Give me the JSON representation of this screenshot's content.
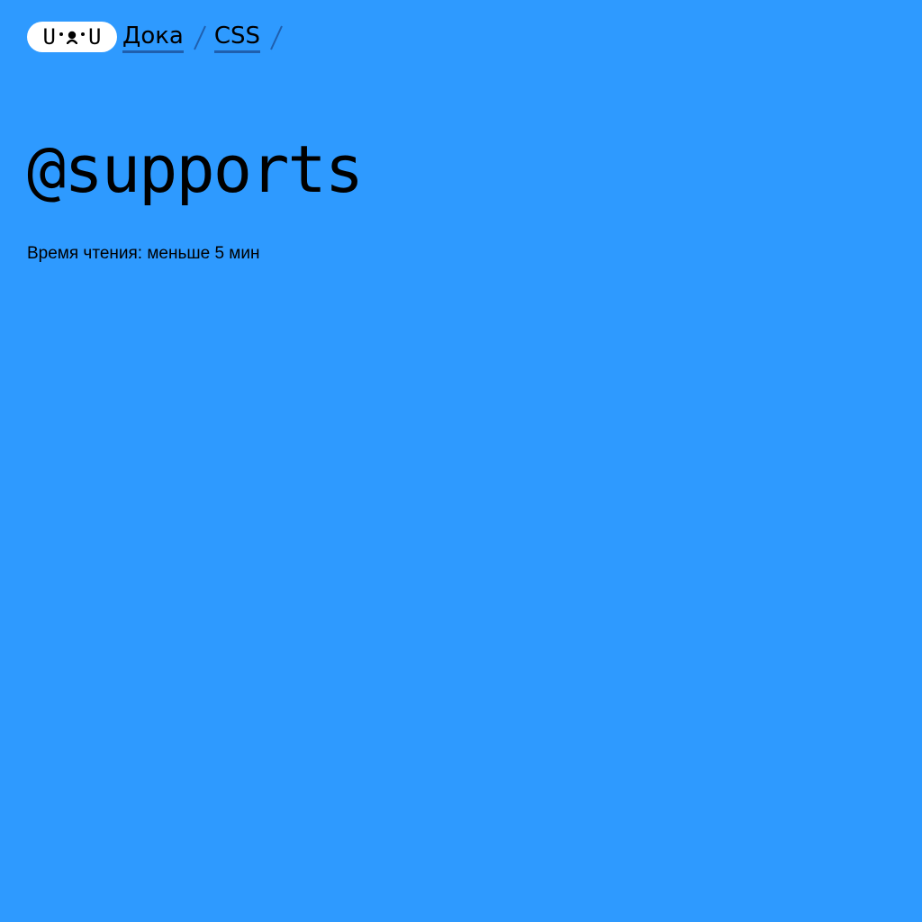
{
  "logo": {
    "left_char": "U",
    "right_char": "U",
    "icon": "doka-face-logo-icon"
  },
  "breadcrumb": {
    "items": [
      {
        "label": "Дока"
      },
      {
        "label": "CSS"
      }
    ],
    "separator_icon": "slash-separator-icon",
    "link_underline_color": "#1f5fae"
  },
  "article": {
    "title": "@supports",
    "reading_time": "Время чтения: меньше 5 мин"
  },
  "theme": {
    "background": "#2e9aff",
    "text": "#000000",
    "logo_background": "#ffffff"
  }
}
